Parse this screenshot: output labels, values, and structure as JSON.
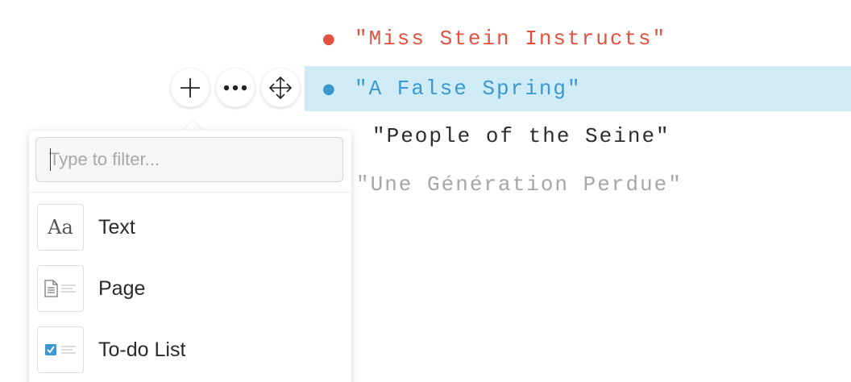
{
  "document": {
    "lines": [
      {
        "bullet": "●",
        "text": "\"Miss Stein Instructs\"",
        "color": "#e0523f"
      },
      {
        "bullet": "●",
        "text": "\"A False Spring\"",
        "color": "#3a97d0",
        "highlight": "#cfecf6"
      },
      {
        "bullet": "",
        "text": "\"People of the Seine\"",
        "color": "#2c2c2c"
      },
      {
        "bullet": "",
        "text": "\"Une Génération Perdue\"",
        "color": "#a6a6a6"
      }
    ]
  },
  "toolbar": {
    "add_icon": "plus-icon",
    "more_icon": "ellipsis-icon",
    "move_icon": "move-arrows-icon"
  },
  "menu": {
    "filter_placeholder": "Type to filter...",
    "filter_value": "",
    "items": [
      {
        "label": "Text",
        "thumb_text": "Aa",
        "icon": "text-type-icon"
      },
      {
        "label": "Page",
        "icon": "page-icon"
      },
      {
        "label": "To-do List",
        "icon": "checkbox-list-icon",
        "accent": "#3a97d0"
      }
    ]
  }
}
